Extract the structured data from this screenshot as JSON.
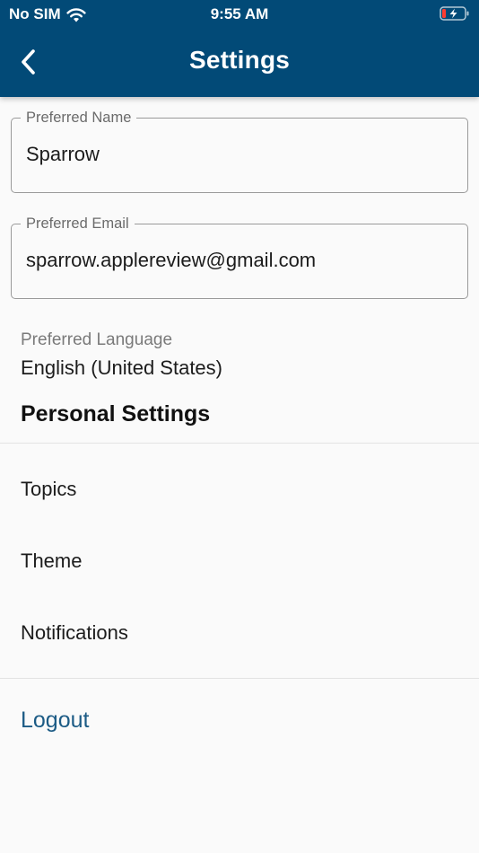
{
  "status_bar": {
    "carrier": "No SIM",
    "time": "9:55 AM",
    "wifi_icon": "wifi-icon",
    "battery_icon": "battery-charging-low-icon",
    "battery_color": "#ff3b30"
  },
  "header": {
    "title": "Settings",
    "back_icon": "chevron-left-icon",
    "background_color": "#024a77"
  },
  "form": {
    "preferred_name": {
      "label": "Preferred Name",
      "value": "Sparrow"
    },
    "preferred_email": {
      "label": "Preferred Email",
      "value": "sparrow.applereview@gmail.com"
    }
  },
  "language": {
    "label": "Preferred Language",
    "value": "English (United States)"
  },
  "personal_settings": {
    "title": "Personal Settings",
    "items": [
      {
        "label": "Topics"
      },
      {
        "label": "Theme"
      },
      {
        "label": "Notifications"
      }
    ]
  },
  "logout": {
    "label": "Logout",
    "color": "#1c5b85"
  }
}
